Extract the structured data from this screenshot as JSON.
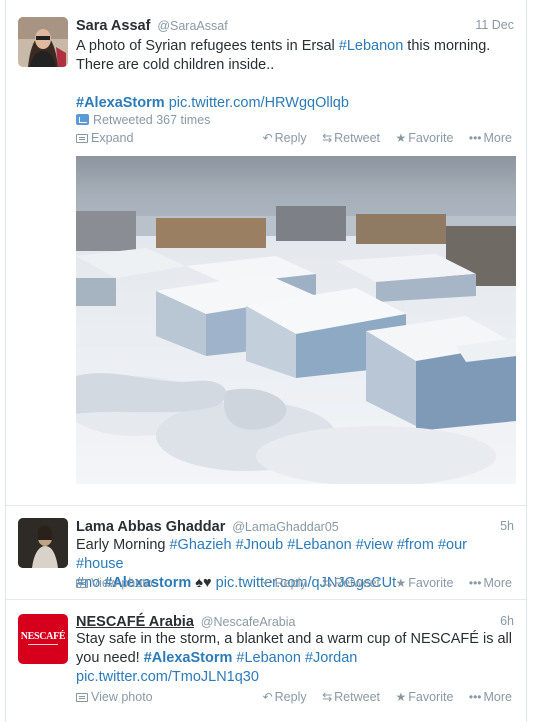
{
  "tweets": [
    {
      "fullname": "Sara Assaf",
      "username": "@SaraAssaf",
      "time": "11 Dec",
      "text_line1_parts": [
        "A photo of Syrian refugees tents in Ersal ",
        "#Lebanon",
        " this morning."
      ],
      "text_line2": "There are cold children inside..",
      "hashtag_line": "#AlexaStorm",
      "link": "pic.twitter.com/HRWgqOllqb",
      "retweeted": "Retweeted 367 times",
      "expand_label": "Expand",
      "actions": {
        "reply": "Reply",
        "retweet": "Retweet",
        "favorite": "Favorite",
        "more": "More"
      }
    },
    {
      "fullname": "Lama Abbas Ghaddar",
      "username": "@LamaGhaddar05",
      "time": "5h",
      "line1": [
        "Early Morning ",
        "#Ghazieh",
        " ",
        "#Jnoub",
        " ",
        "#Lebanon",
        " ",
        "#view",
        " ",
        "#from",
        " ",
        "#our",
        " ",
        "#house"
      ],
      "line2": [
        "#no",
        " ",
        "#Alexastorm",
        " ♠♥ ",
        "pic.twitter.com/qJNJGgsCUt"
      ],
      "expand_label": "View photo",
      "actions": {
        "reply": "Reply",
        "retweet": "Retweet",
        "favorite": "Favorite",
        "more": "More"
      }
    },
    {
      "fullname": "NESCAFÉ Arabia",
      "username": "@NescafeArabia",
      "time": "6h",
      "line1": "Stay safe in the storm, a blanket and a warm cup of NESCAFÉ is all",
      "line2": [
        "you need! ",
        "#AlexaStorm",
        " ",
        "#Lebanon",
        " ",
        "#Jordan"
      ],
      "link": "pic.twitter.com/TmoJLN1q30",
      "expand_label": "View photo",
      "avatar_logo": "NESCAFÉ",
      "actions": {
        "reply": "Reply",
        "retweet": "Retweet",
        "favorite": "Favorite",
        "more": "More"
      }
    }
  ],
  "colors": {
    "link": "#2b7bb9",
    "meta": "#8899a6",
    "nescafe_red": "#d6001c"
  }
}
